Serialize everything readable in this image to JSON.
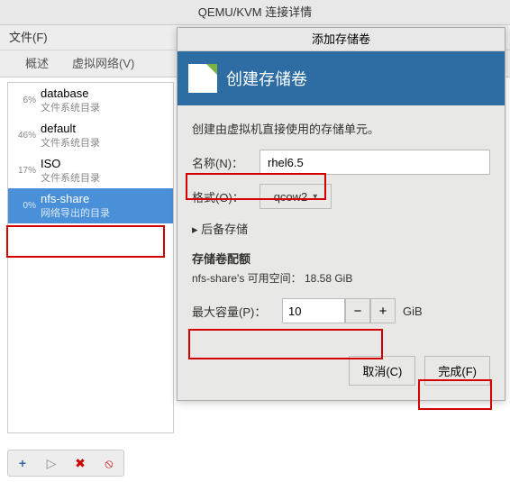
{
  "window": {
    "title": "QEMU/KVM 连接详情"
  },
  "menubar": {
    "file": "文件(F)"
  },
  "tabs": {
    "overview": "概述",
    "virtnet": "虚拟网络(V)"
  },
  "sidebar": {
    "items": [
      {
        "pct": "6%",
        "name": "database",
        "sub": "文件系统目录"
      },
      {
        "pct": "46%",
        "name": "default",
        "sub": "文件系统目录"
      },
      {
        "pct": "17%",
        "name": "ISO",
        "sub": "文件系统目录"
      },
      {
        "pct": "0%",
        "name": "nfs-share",
        "sub": "网络导出的目录"
      }
    ]
  },
  "dialog": {
    "title": "添加存储卷",
    "header": "创建存储卷",
    "desc": "创建由虚拟机直接使用的存储单元。",
    "name_label": "名称(N)：",
    "name_value": "rhel6.5",
    "format_label": "格式(O)：",
    "format_value": "qcow2",
    "backing_label": "后备存储",
    "quota_title": "存储卷配额",
    "available": "nfs-share's 可用空间： 18.58 GiB",
    "max_label": "最大容量(P)：",
    "max_value": "10",
    "unit": "GiB",
    "cancel": "取消(C)",
    "finish": "完成(F)"
  },
  "icons": {
    "plus": "+",
    "play": "▷",
    "delete": "✖",
    "stop": "⦸",
    "chevron": "▾",
    "right": "▸",
    "minus": "−"
  }
}
